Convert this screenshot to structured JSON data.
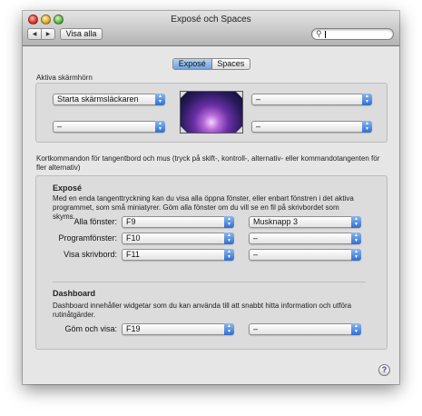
{
  "window": {
    "title": "Exposé och Spaces"
  },
  "toolbar": {
    "back_icon": "back-arrow-icon",
    "forward_icon": "forward-arrow-icon",
    "show_all_label": "Visa alla"
  },
  "search": {
    "value": "",
    "icon": "magnifier-icon"
  },
  "tabs": [
    {
      "label": "Exposé",
      "selected": true
    },
    {
      "label": "Spaces",
      "selected": false
    }
  ],
  "hot_corners": {
    "heading": "Aktiva skärmhörn",
    "top_left": "Starta skärmsläckaren",
    "top_right": "–",
    "bottom_left": "–",
    "bottom_right": "–"
  },
  "shortcuts": {
    "heading": "Kortkommandon för tangentbord och mus (tryck på skift-, kontroll-, alternativ- eller kommandotangenten för fler alternativ)"
  },
  "expose": {
    "title": "Exposé",
    "description": "Med en enda tangenttryckning kan du visa alla öppna fönster, eller enbart fönstren i det aktiva programmet, som små miniatyrer. Göm alla fönster om du vill se en fil på skrivbordet som skyms.",
    "rows": [
      {
        "label": "Alla fönster:",
        "key": "F9",
        "mouse": "Musknapp 3"
      },
      {
        "label": "Programfönster:",
        "key": "F10",
        "mouse": "–"
      },
      {
        "label": "Visa skrivbord:",
        "key": "F11",
        "mouse": "–"
      }
    ]
  },
  "dashboard": {
    "title": "Dashboard",
    "description": "Dashboard innehåller widgetar som du kan använda till att snabbt hitta information och utföra rutinåtgärder.",
    "row": {
      "label": "Göm och visa:",
      "key": "F19",
      "mouse": "–"
    }
  },
  "help": {
    "label": "?"
  }
}
